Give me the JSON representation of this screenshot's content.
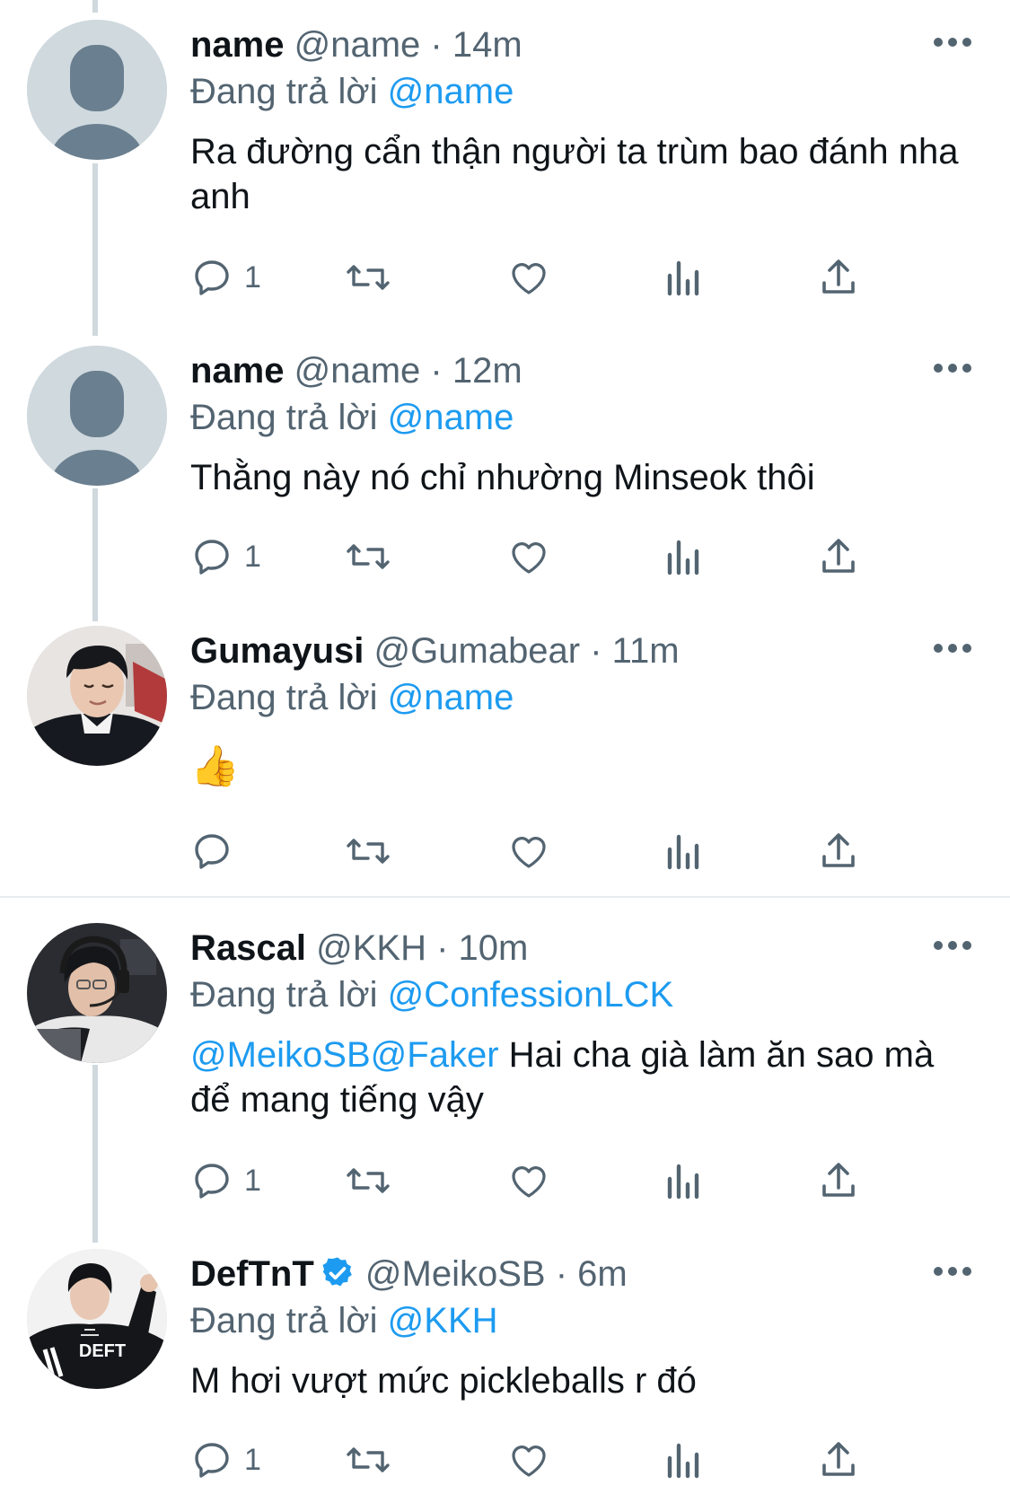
{
  "icons": {
    "reply": "speech-bubble-icon",
    "retweet": "retweet-icon",
    "like": "heart-icon",
    "views": "bar-chart-icon",
    "share": "share-upload-icon",
    "more": "three-dots-icon",
    "verified": "verified-badge-icon"
  },
  "colors": {
    "link": "#1d9bf0",
    "muted": "#536471",
    "text": "#0f1419",
    "thread_line": "#cfd9de"
  },
  "tweets": [
    {
      "name": "name",
      "handle": "@name",
      "time": "· 14m",
      "reply_prefix": "Đang trả lời",
      "reply_to": "@name",
      "text": "Ra đường cẩn thận người ta trùm bao đánh nha anh",
      "reply_count": "1"
    },
    {
      "name": "name",
      "handle": "@name",
      "time": "· 12m",
      "reply_prefix": "Đang trả lời",
      "reply_to": "@name",
      "text": "Thằng này nó chỉ nhường Minseok thôi",
      "reply_count": "1"
    },
    {
      "name": "Gumayusi",
      "handle": "@Gumabear",
      "time": "· 11m",
      "reply_prefix": "Đang trả lời",
      "reply_to": "@name",
      "emoji": "👍",
      "reply_count": ""
    },
    {
      "name": "Rascal",
      "handle": "@KKH",
      "time": "· 10m",
      "reply_prefix": "Đang trả lời",
      "reply_to": "@ConfessionLCK",
      "mentions": "@MeikoSB@Faker",
      "text": " Hai cha già làm ăn sao mà để mang tiếng vậy",
      "reply_count": "1"
    },
    {
      "name": "DefTnT",
      "handle": "@MeikoSB",
      "time": "· 6m",
      "reply_prefix": "Đang trả lời",
      "reply_to": "@KKH",
      "text": "M hơi vượt mức pickleballs r đó",
      "reply_count": "1",
      "avatar_text": "DEFT"
    }
  ]
}
